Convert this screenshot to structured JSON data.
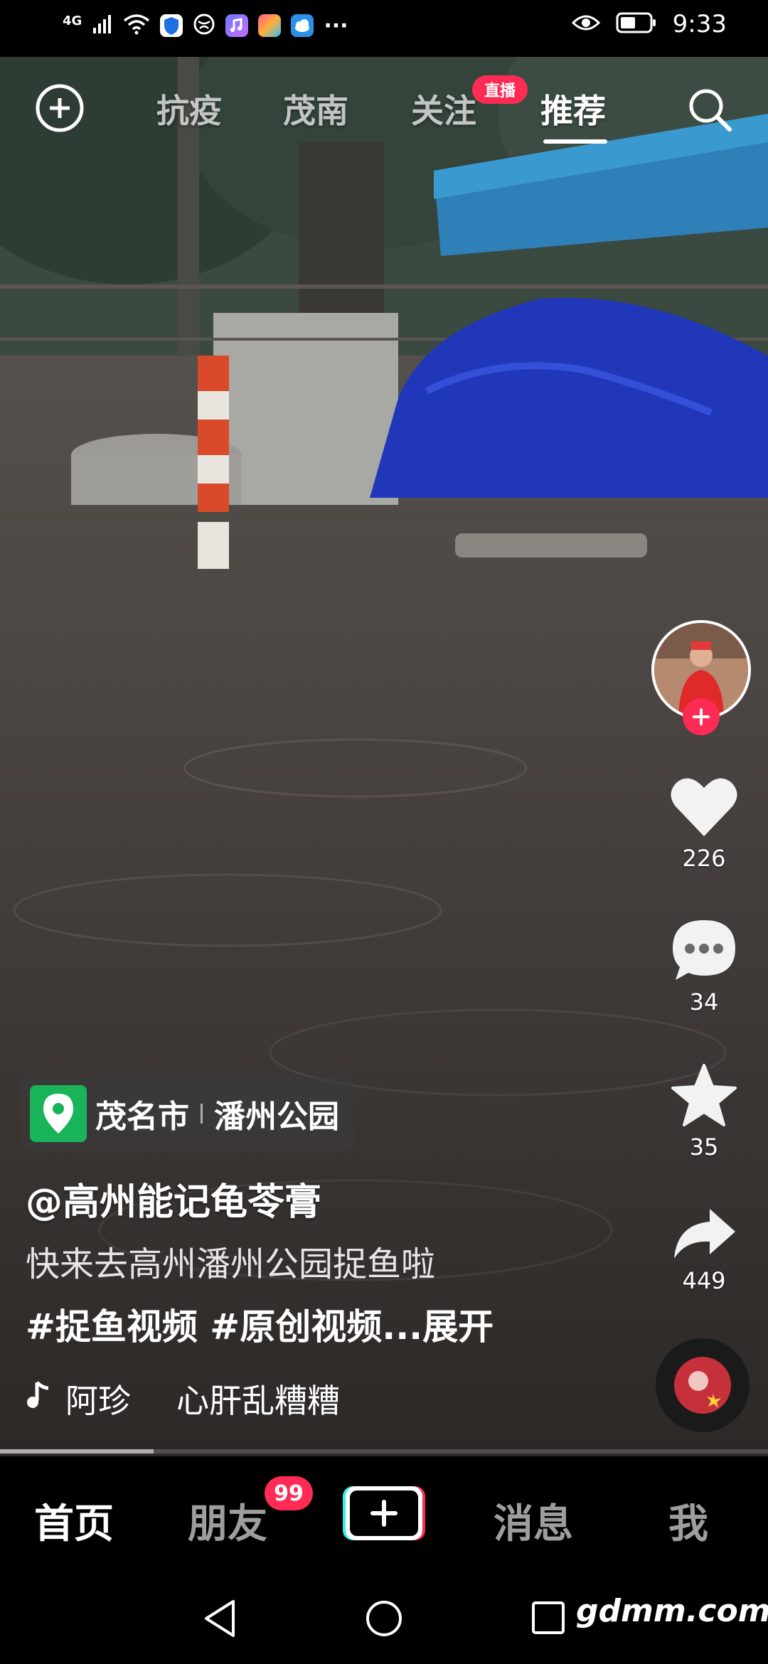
{
  "status_bar": {
    "network": "4G",
    "time": "9:33",
    "more": "···",
    "icons": [
      "signal-icon",
      "wifi-icon",
      "shield-app-icon",
      "browser-app-icon",
      "music-app-icon",
      "photo-app-icon",
      "weather-app-icon",
      "eye-icon",
      "battery-icon"
    ]
  },
  "top_nav": {
    "tabs": [
      {
        "label": "抗疫"
      },
      {
        "label": "茂南"
      },
      {
        "label": "关注"
      },
      {
        "label": "推荐"
      }
    ],
    "active_tab": "推荐",
    "live_badge": "直播"
  },
  "side_actions": {
    "likes": "226",
    "comments": "34",
    "favorites": "35",
    "shares": "449"
  },
  "caption": {
    "location_city": "茂名市",
    "location_place": "潘州公园",
    "author": "@高州能记龟苓膏",
    "description": "快来去高州潘州公园捉鱼啦",
    "hashtags": "#捉鱼视频 #原创视频...",
    "expand": "展开",
    "music_artist": "阿珍",
    "music_title": "心肝乱糟糟"
  },
  "progress": 0.2,
  "bottom_nav": {
    "home": "首页",
    "friends": "朋友",
    "friends_badge": "99",
    "messages": "消息",
    "me": "我"
  },
  "watermark": "gdmm.com",
  "colors": {
    "accent": "#fe2c55",
    "location_green": "#19b45a",
    "tarp_blue": "#1f37b8"
  }
}
